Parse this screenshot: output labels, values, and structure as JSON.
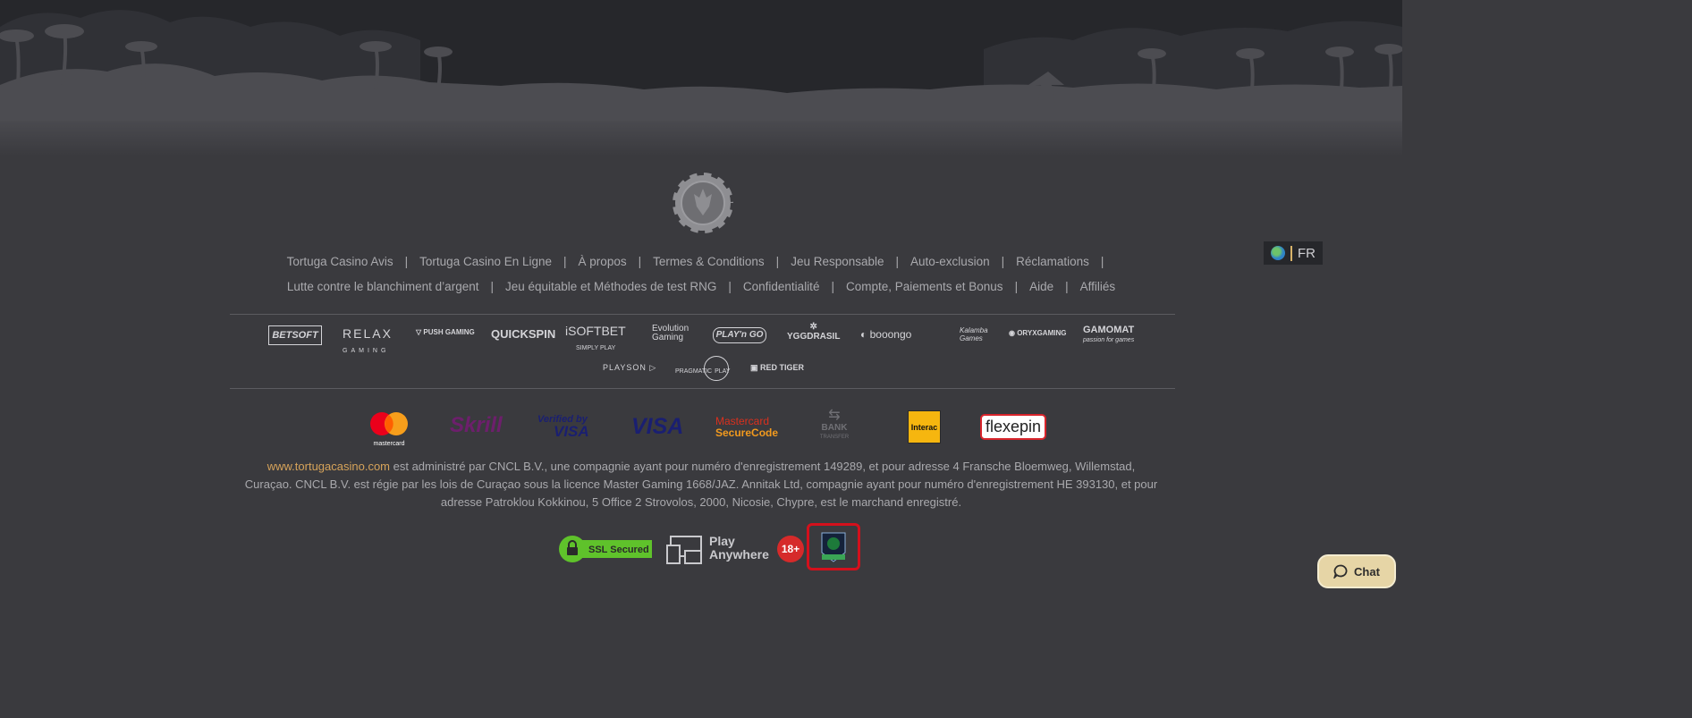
{
  "language": {
    "code": "FR",
    "icon": "globe-icon"
  },
  "nav": {
    "row1": [
      "Tortuga Casino Avis",
      "Tortuga Casino En Ligne",
      "À propos",
      "Termes & Conditions",
      "Jeu Responsable",
      "Auto-exclusion",
      "Réclamations"
    ],
    "row2": [
      "Lutte contre le blanchiment d’argent",
      "Jeu équitable et Méthodes de test RNG",
      "Confidentialité",
      "Compte, Paiements et Bonus",
      "Aide",
      "Affiliés"
    ],
    "separator": "|"
  },
  "providers": {
    "betsoft": "BETSOFT",
    "relax": "RELAX",
    "relax_sub": "GAMING",
    "push": "PUSH GAMING",
    "quickspin": "QUICKSPIN",
    "isoftbet": "iSOFTBET",
    "isoftbet_sub": "SIMPLY PLAY",
    "evolution_1": "Evolution",
    "evolution_2": "Gaming",
    "playngo": "PLAY'n GO",
    "yggdrasil": "YGGDRASIL",
    "booongo": "booongo",
    "kalamba_1": "Kalamba",
    "kalamba_2": "Games",
    "oryx": "ORYXGAMING",
    "gamomat": "GAMOMAT",
    "gamomat_sub": "passion for games",
    "playson": "PLAYSON",
    "pragmatic_1": "PRAGMATIC",
    "pragmatic_2": "PLAY",
    "redtiger": "RED TIGER"
  },
  "payments": {
    "mastercard": "mastercard",
    "skrill": "Skrill",
    "verified_1": "Verified by",
    "verified_2": "VISA",
    "visa": "VISA",
    "msc_1": "Mastercard",
    "msc_2": "SecureCode",
    "bank_1": "BANK",
    "bank_2": "TRANSFER",
    "interac": "Interac",
    "flexepin": "flexepin"
  },
  "legal": {
    "site_link": "www.tortugacasino.com",
    "text": " est administré par CNCL B.V., une compagnie ayant pour numéro d'enregistrement 149289, et pour adresse 4 Fransche Bloemweg, Willemstad, Curaçao. CNCL B.V. est régie par les lois de Curaçao sous la licence Master Gaming 1668/JAZ. Annitak Ltd, compagnie ayant pour numéro d'enregistrement HE 393130, et pour adresse Patroklou Kokkinou, 5 Office 2 Strovolos, 2000, Nicosie, Chypre, est le marchand enregistré."
  },
  "badges": {
    "ssl": "SSL Secured",
    "play_1": "Play",
    "play_2": "Anywhere",
    "age": "18+"
  },
  "chat": {
    "label": "Chat"
  },
  "colors": {
    "accent": "#d6a35a",
    "background": "#3a3a3e",
    "ssl_green": "#5fc22b",
    "highlight_red": "#d4101c"
  }
}
